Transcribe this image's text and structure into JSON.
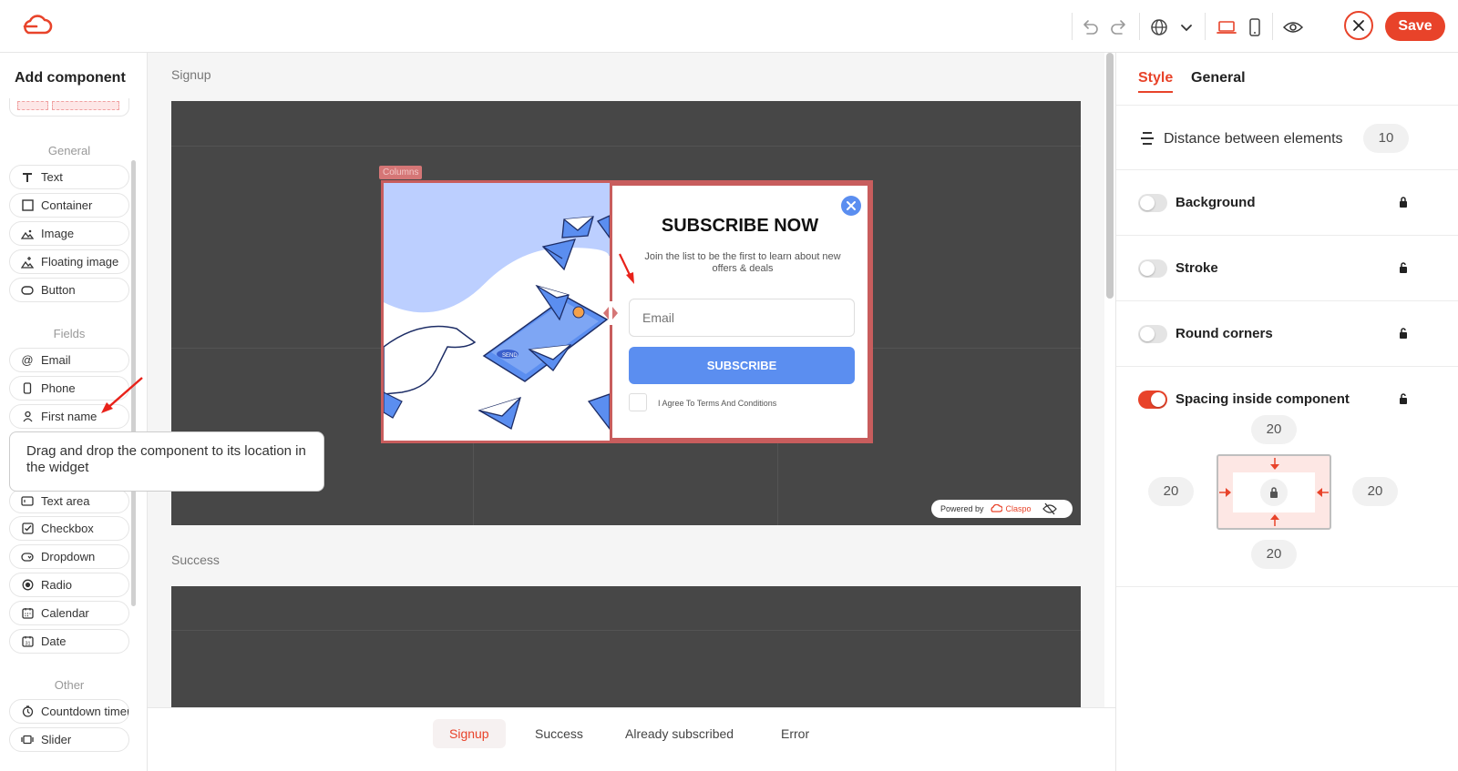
{
  "colors": {
    "accent": "#e8432a",
    "popup_blue": "#5b8ef0",
    "stage": "#474747"
  },
  "toolbar": {
    "logo": "claspo-cloud-logo",
    "icons": [
      "undo-icon",
      "redo-icon",
      "globe-icon",
      "chevron-down-icon",
      "desktop-icon",
      "mobile-icon",
      "eye-icon",
      "close-icon"
    ],
    "save_label": "Save"
  },
  "sidebar": {
    "title": "Add component",
    "general_heading": "General",
    "general_items": [
      "Text",
      "Container",
      "Image",
      "Floating image",
      "Button"
    ],
    "fields_heading": "Fields",
    "fields_items": [
      "Email",
      "Phone",
      "First name",
      "Text area",
      "Checkbox",
      "Dropdown",
      "Radio",
      "Calendar",
      "Date"
    ],
    "other_heading": "Other",
    "other_items": [
      "Countdown timer",
      "Slider"
    ],
    "tooltip": "Drag and drop the component to its location in the widget"
  },
  "canvas": {
    "signup_label": "Signup",
    "success_label": "Success",
    "columns_tag": "Columns",
    "popup": {
      "title": "SUBSCRIBE NOW",
      "subtitle": "Join the list to be the first to learn about new offers & deals",
      "email_placeholder": "Email",
      "button_label": "SUBSCRIBE",
      "agree_label": "I Agree To Terms And Conditions"
    },
    "powered_by": "Powered by",
    "powered_brand": "Claspo"
  },
  "bottom_tabs": [
    "Signup",
    "Success",
    "Already subscribed",
    "Error"
  ],
  "active_bottom_tab": "Signup",
  "right_panel": {
    "tabs": [
      "Style",
      "General"
    ],
    "active_tab": "Style",
    "distance_label": "Distance between elements",
    "distance_value": "10",
    "background_label": "Background",
    "background_on": false,
    "stroke_label": "Stroke",
    "stroke_on": false,
    "round_label": "Round corners",
    "round_on": false,
    "spacing_label": "Spacing inside component",
    "spacing_on": true,
    "spacing": {
      "top": "20",
      "left": "20",
      "right": "20",
      "bottom": "20"
    }
  }
}
